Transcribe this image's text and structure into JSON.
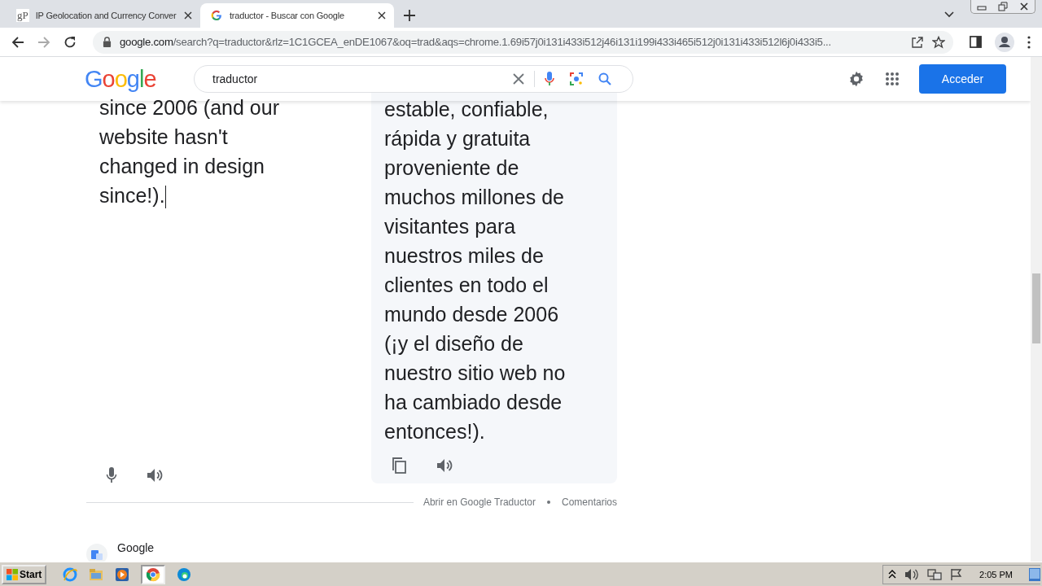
{
  "browser": {
    "tabs": [
      {
        "title": "IP Geolocation and Currency Conver",
        "favicon": "gP",
        "selected": false
      },
      {
        "title": "traductor - Buscar con Google",
        "selected": true
      }
    ],
    "url": {
      "host": "google.com",
      "path": "/search?q=traductor&rlz=1C1GCEA_enDE1067&oq=trad&aqs=chrome.1.69i57j0i131i433i512j46i131i199i433i465i512j0i131i433i512l6j0i433i5..."
    }
  },
  "header": {
    "logo": "Google",
    "search": {
      "value": "traductor"
    },
    "sign_in": "Acceder"
  },
  "translator": {
    "source_lines": [
      "since 2006 (and our",
      "website hasn't",
      "changed in design",
      "since!)."
    ],
    "target_lines": [
      "estable, confiable,",
      "rápida y gratuita",
      "proveniente de",
      "muchos millones de",
      "visitantes para",
      "nuestros miles de",
      "clientes en todo el",
      "mundo desde 2006",
      "(¡y el diseño de",
      "nuestro sitio web no",
      "ha cambiado desde",
      "entonces!)."
    ],
    "links": [
      "Abrir en Google Traductor",
      "Comentarios"
    ]
  },
  "next_result": {
    "site": "Google"
  },
  "taskbar": {
    "start": "Start",
    "clock": "2:05 PM"
  }
}
